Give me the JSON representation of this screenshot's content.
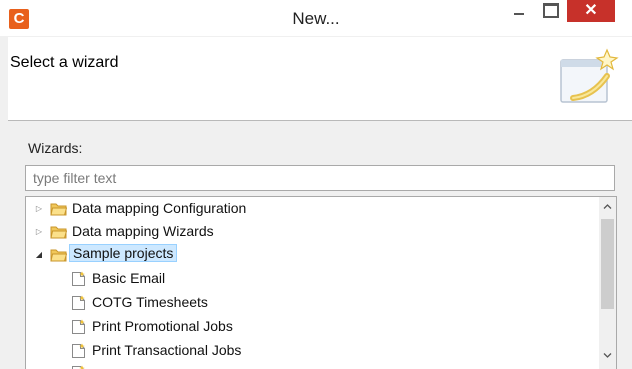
{
  "window": {
    "app_icon_letter": "C",
    "title": "New...",
    "close_glyph": "✕"
  },
  "banner": {
    "title": "Select a wizard",
    "graphic_icon": "wizard-banner-icon"
  },
  "wizards": {
    "label": "Wizards:",
    "filter_placeholder": "type filter text",
    "filter_value": ""
  },
  "tree": {
    "items": [
      {
        "label": "Data mapping Configuration",
        "type": "folder",
        "expanded": false,
        "level": 0,
        "selected": false
      },
      {
        "label": "Data mapping Wizards",
        "type": "folder",
        "expanded": false,
        "level": 0,
        "selected": false
      },
      {
        "label": "Sample projects",
        "type": "folder",
        "expanded": true,
        "level": 0,
        "selected": true
      },
      {
        "label": "Basic Email",
        "type": "file",
        "level": 1
      },
      {
        "label": "COTG Timesheets",
        "type": "file",
        "level": 1
      },
      {
        "label": "Print Promotional Jobs",
        "type": "file",
        "level": 1
      },
      {
        "label": "Print Transactional Jobs",
        "type": "file",
        "level": 1
      }
    ]
  },
  "colors": {
    "app_icon": "#e8601c",
    "close_button": "#c7312a",
    "selection": "#cde8ff",
    "folder": "#e8b94a"
  }
}
